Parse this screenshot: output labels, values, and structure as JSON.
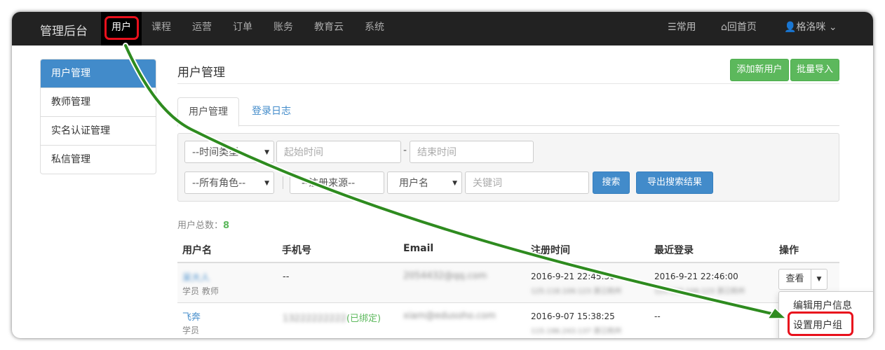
{
  "navbar": {
    "brand": "管理后台",
    "items": [
      "用户",
      "课程",
      "运营",
      "订单",
      "账务",
      "教育云",
      "系统"
    ],
    "right": {
      "common": "常用",
      "home": "回首页",
      "user": "格洛咪"
    }
  },
  "sidebar": {
    "items": [
      "用户管理",
      "教师管理",
      "实名认证管理",
      "私信管理"
    ]
  },
  "page": {
    "title": "用户管理",
    "add_user": "添加新用户",
    "bulk_import": "批量导入"
  },
  "tabs": [
    "用户管理",
    "登录日志"
  ],
  "search": {
    "time_type": "--时间类型--",
    "start_time_placeholder": "起始时间",
    "dash": "-",
    "end_time_placeholder": "结束时间",
    "role": "--所有角色--",
    "source": "--注册来源--",
    "keyword_type": "用户名",
    "keyword_placeholder": "关键词",
    "search_button": "搜索",
    "export_button": "导出搜索结果"
  },
  "summary": {
    "label": "用户总数：",
    "count": "8"
  },
  "table": {
    "headers": [
      "用户名",
      "手机号",
      "Email",
      "注册时间",
      "最近登录",
      "操作"
    ],
    "rows": [
      {
        "name": "呆大人",
        "roles": "学员 教师",
        "phone": "--",
        "phone_bound": "",
        "email": "2054432@qq.com",
        "reg_time": "2016-9-21 22:45:36",
        "reg_ip": "125.118.109.123 浙江杭州",
        "last_login": "2016-9-21 22:46:00",
        "last_ip": "125.118.109.123 浙江杭州"
      },
      {
        "name": "飞奔",
        "roles": "学员",
        "phone": "13222222222",
        "phone_bound": "(已绑定)",
        "email": "xiam@edusoho.com",
        "reg_time": "2016-9-07 15:38:25",
        "reg_ip": "115.196.243.137 浙江杭州",
        "last_login": "--",
        "last_ip": ""
      }
    ],
    "view_button": "查看"
  },
  "dropdown": {
    "items": [
      "编辑用户信息",
      "设置用户组"
    ]
  },
  "colors": {
    "highlight": "#e8101c",
    "arrow": "#2e8b1f",
    "primary": "#428bca",
    "success": "#5cb85c"
  }
}
